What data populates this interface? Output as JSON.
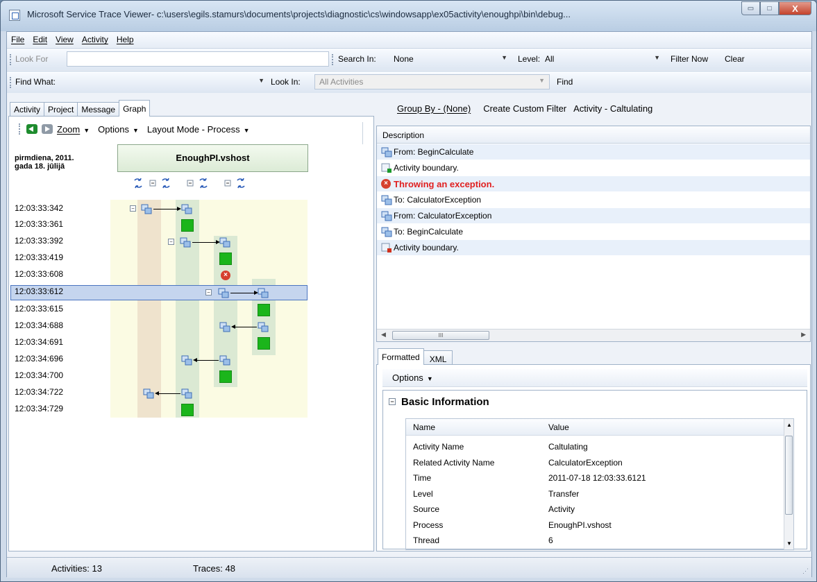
{
  "window": {
    "title": "Microsoft Service Trace Viewer- c:\\users\\egils.stamurs\\documents\\projects\\diagnostic\\cs\\windowsapp\\ex05activity\\enoughpi\\bin\\debug...",
    "min_glyph": "▭",
    "max_glyph": "□",
    "close_glyph": "X"
  },
  "menu": [
    "File",
    "Edit",
    "View",
    "Activity",
    "Help"
  ],
  "toolbar1": {
    "look_for_label": "Look For",
    "look_for_value": "",
    "search_in_label": "Search In:",
    "search_in_value": "None",
    "level_label": "Level:",
    "level_value": "All",
    "filter_now": "Filter Now",
    "clear": "Clear"
  },
  "toolbar2": {
    "find_what_label": "Find What:",
    "find_what_value": "",
    "look_in_label": "Look In:",
    "look_in_value": "All Activities",
    "find": "Find"
  },
  "left_tabs": [
    "Activity",
    "Project",
    "Message",
    "Graph"
  ],
  "graph_toolbar": {
    "zoom": "Zoom",
    "options": "Options",
    "layout_mode": "Layout Mode - Process"
  },
  "graph": {
    "date_line1": "pirmdiena, 2011.",
    "date_line2": "gada 18. jūlijā",
    "process_name": "EnoughPI.vshost",
    "times": [
      "12:03:33:342",
      "12:03:33:361",
      "12:03:33:392",
      "12:03:33:419",
      "12:03:33:608",
      "12:03:33:612",
      "12:03:33:615",
      "12:03:34:688",
      "12:03:34:691",
      "12:03:34:696",
      "12:03:34:700",
      "12:03:34:722",
      "12:03:34:729"
    ],
    "selected_index": 5
  },
  "right_header": {
    "group_by": "Group By - (None)",
    "create_filter": "Create Custom Filter",
    "activity": "Activity - Caltulating"
  },
  "description": {
    "header": "Description",
    "rows": [
      {
        "text": "From: BeginCalculate",
        "icon": "transfer-icon",
        "error": false
      },
      {
        "text": "Activity boundary.",
        "icon": "activity-start-icon",
        "error": false
      },
      {
        "text": "Throwing an exception.",
        "icon": "error-icon",
        "error": true
      },
      {
        "text": "To: CalculatorException",
        "icon": "transfer-icon",
        "error": false
      },
      {
        "text": "From: CalculatorException",
        "icon": "transfer-icon",
        "error": false
      },
      {
        "text": "To: BeginCalculate",
        "icon": "transfer-icon",
        "error": false
      },
      {
        "text": "Activity boundary.",
        "icon": "activity-stop-icon",
        "error": false
      }
    ],
    "scroll_thumb_glyph": "III"
  },
  "detail_tabs": [
    "Formatted",
    "XML"
  ],
  "detail": {
    "options": "Options",
    "section_title": "Basic Information",
    "col_name": "Name",
    "col_value": "Value",
    "rows": [
      {
        "name": "Activity Name",
        "value": "Caltulating"
      },
      {
        "name": "Related Activity Name",
        "value": "CalculatorException"
      },
      {
        "name": "Time",
        "value": "2011-07-18 12:03:33.6121"
      },
      {
        "name": "Level",
        "value": "Transfer"
      },
      {
        "name": "Source",
        "value": "Activity"
      },
      {
        "name": "Process",
        "value": "EnoughPI.vshost"
      },
      {
        "name": "Thread",
        "value": "6"
      }
    ]
  },
  "status": {
    "activities": "Activities: 13",
    "traces": "Traces: 48"
  },
  "colors": {
    "error": "#e02020",
    "selection": "#c5d5ee",
    "activity_box": "#1bb51b"
  }
}
